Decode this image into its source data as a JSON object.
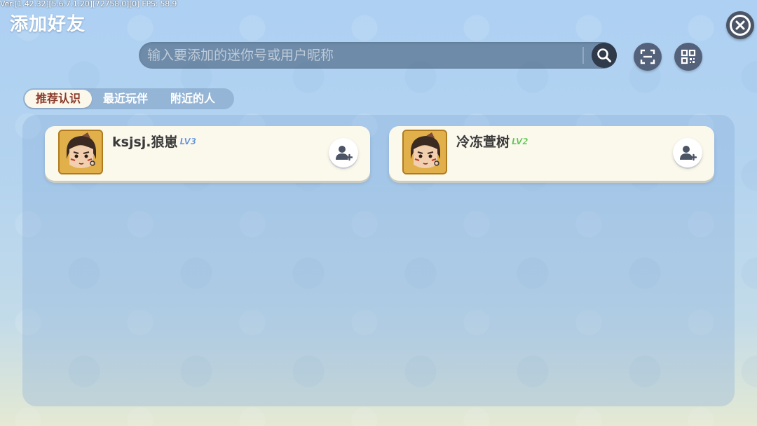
{
  "debug_info": "Ver:[1.42.32][5.6.7.1:20][72758.0][0] FPS: 58.9",
  "header": {
    "title": "添加好友",
    "close_icon": "close-icon"
  },
  "search": {
    "placeholder": "输入要添加的迷你号或用户昵称",
    "value": "",
    "search_icon": "search-icon",
    "scan_icon": "scan-icon",
    "qr_icon": "qr-code-icon"
  },
  "tabs": [
    {
      "label": "推荐认识",
      "active": true
    },
    {
      "label": "最近玩伴",
      "active": false
    },
    {
      "label": "附近的人",
      "active": false
    }
  ],
  "friends": [
    {
      "name": "ksjsj.狼崽",
      "level": "LV3",
      "level_color": "#5b8fd6",
      "action_icon": "add-user-icon"
    },
    {
      "name": "冷冻萱树",
      "level": "LV2",
      "level_color": "#5cc24a",
      "action_icon": "add-user-icon"
    }
  ],
  "colors": {
    "active_tab_text": "#8a3a2a",
    "card_bg": "#fbf8ec",
    "avatar_frame": "#d8a23a"
  }
}
